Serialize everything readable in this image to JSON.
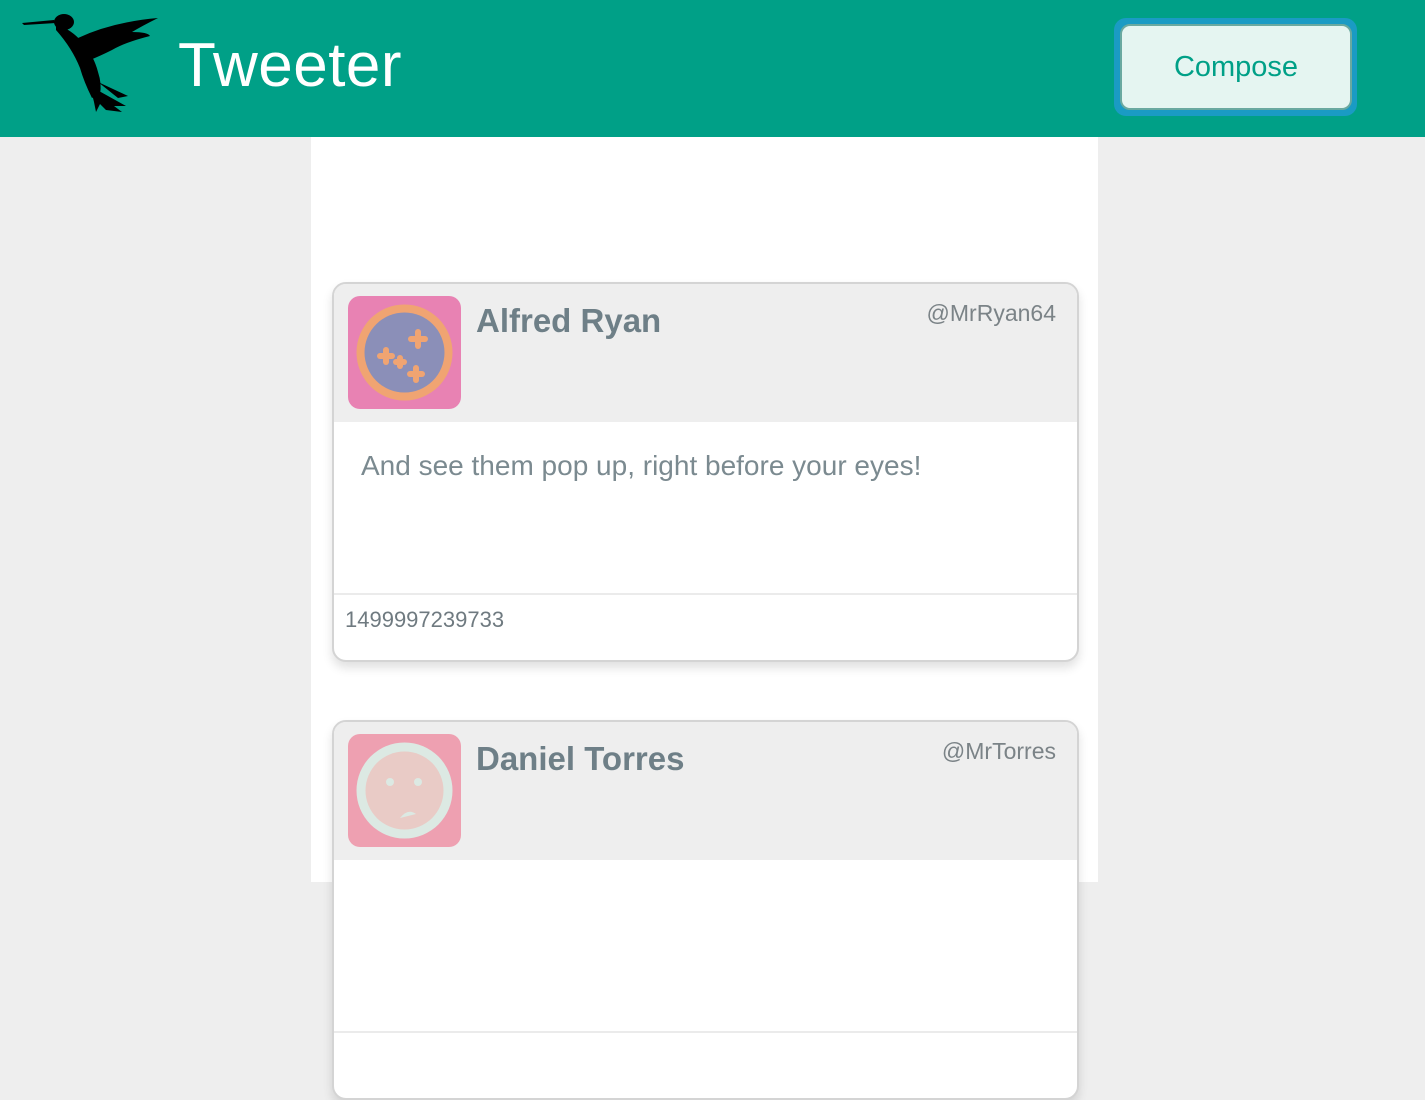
{
  "nav": {
    "brand": "Tweeter",
    "logo_icon": "hummingbird-icon",
    "compose_label": "Compose"
  },
  "colors": {
    "brand_green": "#00a087",
    "compose_bg": "#e5f5f1",
    "focus_ring": "#1a9bc4",
    "name_text": "#6e7f87"
  },
  "tweets": [
    {
      "name": "Alfred Ryan",
      "handle": "@MrRyan64",
      "avatar_icon": "crossed-eyes-face-icon",
      "content": "And see them pop up, right before your eyes!",
      "timestamp": "1499997239733"
    },
    {
      "name": "Daniel Torres",
      "handle": "@MrTorres",
      "avatar_icon": "sad-face-icon",
      "content": "",
      "timestamp": ""
    }
  ]
}
